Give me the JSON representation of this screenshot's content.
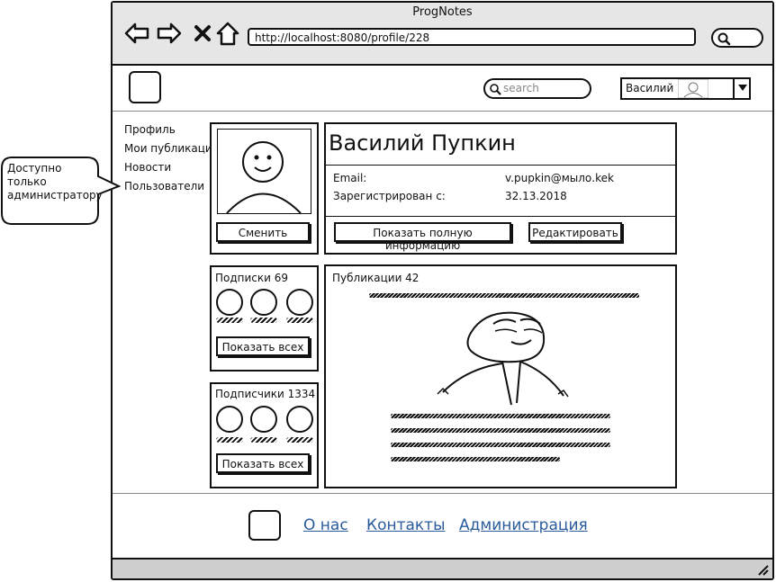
{
  "window": {
    "title": "ProgNotes"
  },
  "browser": {
    "url": "http://localhost:8080/profile/228"
  },
  "header": {
    "search_placeholder": "search",
    "user_name": "Василий"
  },
  "sidebar": {
    "items": [
      {
        "label": "Профиль"
      },
      {
        "label": "Мои публикации"
      },
      {
        "label": "Новости"
      },
      {
        "label": "Пользователи"
      }
    ],
    "admin_note": "Доступно только администратору"
  },
  "profile": {
    "change_photo_label": "Сменить",
    "full_name": "Василий Пупкин",
    "email_label": "Email:",
    "email_value": "v.pupkin@мыло.kek",
    "registered_label": "Зарегистрирован с:",
    "registered_value": "32.13.2018",
    "show_full_info_label": "Показать полную информацию",
    "edit_label": "Редактировать"
  },
  "subscriptions": {
    "title": "Подписки 69",
    "show_all_label": "Показать всех"
  },
  "subscribers": {
    "title": "Подписчики 1334",
    "show_all_label": "Показать всех"
  },
  "publications": {
    "title": "Публикации 42"
  },
  "footer": {
    "links": [
      {
        "label": "О нас"
      },
      {
        "label": "Контакты"
      },
      {
        "label": "Администрация"
      }
    ]
  }
}
